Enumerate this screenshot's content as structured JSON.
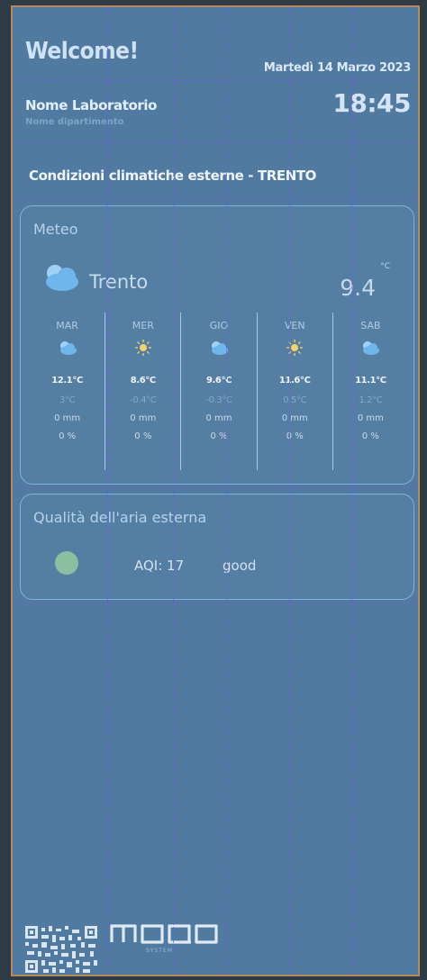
{
  "header": {
    "welcome": "Welcome!",
    "date": "Martedì 14 Marzo 2023",
    "lab_name": "Nome Laboratorio",
    "department": "Nome dipartimento",
    "time": "18:45"
  },
  "section_title": "Condizioni climatiche esterne - TRENTO",
  "meteo": {
    "title": "Meteo",
    "city": "Trento",
    "temperature": "9.4",
    "unit": "°C",
    "current_icon": "cloud-icon",
    "days": [
      {
        "name": "MAR",
        "icon": "cloud-icon",
        "max": "12.1°C",
        "min": "3°C",
        "rain": "0 mm",
        "prob": "0 %"
      },
      {
        "name": "MER",
        "icon": "sun-icon",
        "max": "8.6°C",
        "min": "-0.4°C",
        "rain": "0 mm",
        "prob": "0 %"
      },
      {
        "name": "GIO",
        "icon": "cloud-icon",
        "max": "9.6°C",
        "min": "-0.3°C",
        "rain": "0 mm",
        "prob": "0 %"
      },
      {
        "name": "VEN",
        "icon": "sun-icon",
        "max": "11.6°C",
        "min": "0.5°C",
        "rain": "0 mm",
        "prob": "0 %"
      },
      {
        "name": "SAB",
        "icon": "cloud-icon",
        "max": "11.1°C",
        "min": "1.2°C",
        "rain": "0 mm",
        "prob": "0 %"
      }
    ]
  },
  "air_quality": {
    "title": "Qualità dell'aria esterna",
    "aqi": "AQI: 17",
    "status": "good",
    "status_color": "#8bbfa0"
  },
  "footer": {
    "logo": "moqa",
    "logo_sub": "SYSTEM"
  },
  "colors": {
    "background": "#507aa0",
    "accent": "#7fb4e0",
    "border": "#b8895a"
  }
}
